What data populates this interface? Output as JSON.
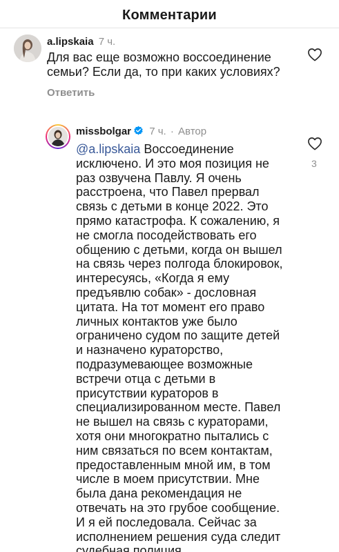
{
  "header": {
    "title": "Комментарии"
  },
  "comment1": {
    "username": "a.lipskaia",
    "time": "7 ч.",
    "lines": [
      "Для вас еще возможно воссоединение",
      "семьи? Если да, то при каких условиях?"
    ],
    "reply_label": "Ответить",
    "like_icon": "heart-icon"
  },
  "comment2": {
    "username": "missbolgar",
    "separator": "·",
    "time": "7 ч.",
    "author_badge": "Автор",
    "verified_icon": "verified-badge-icon",
    "mention": "@a.lipskaia",
    "first_line_rest": " Воссоединение",
    "lines": [
      "исключено. И это моя позиция не",
      "раз озвучена Павлу. Я очень",
      "расстроена, что Павел прервал",
      "связь с детьми в конце 2022. Это",
      "прямо катастрофа. К сожалению, я",
      "не смогла посодействовать его",
      "общению с детьми, когда он вышел",
      "на связь через полгода блокировок,",
      "интересуясь, «Когда я ему",
      "предъявлю собак» - дословная",
      "цитата. На тот момент его право",
      "личных контактов уже было",
      "ограничено судом по защите детей",
      "и назначено кураторство,",
      "подразумевающее возможные",
      "встречи отца с детьми в",
      "присутствии кураторов в",
      "специализированном месте. Павел",
      "не вышел на связь с кураторами,",
      "хотя они многократно пытались с",
      "ним связаться по всем контактам,",
      "предоставленным мной им, в том",
      "числе в моем присутствии. Мне",
      "была дана рекомендация не",
      "отвечать на это грубое сообщение.",
      "И я ей последовала. Сейчас за",
      "исполнением решения суда следит",
      "судебная полиция."
    ],
    "like_icon": "heart-icon",
    "like_count": "3"
  },
  "colors": {
    "text": "#1a1a1a",
    "muted": "#8e8e8e",
    "mention": "#385898",
    "verified": "#0095f6"
  }
}
